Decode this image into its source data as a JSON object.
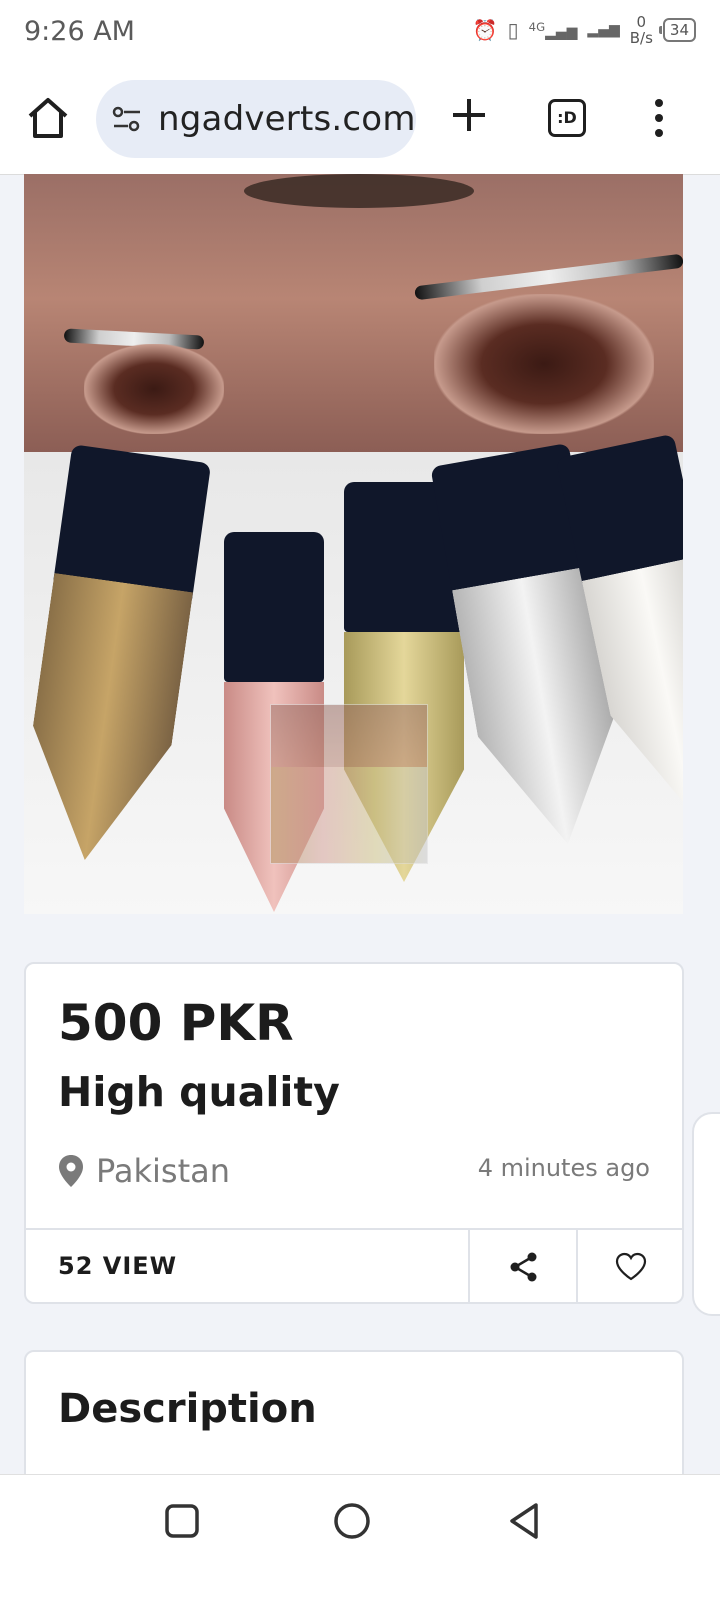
{
  "status_bar": {
    "time": "9:26 AM",
    "network": "4G",
    "speed_value": "0",
    "speed_unit": "B/s",
    "battery": "34"
  },
  "browser": {
    "url": "ngadverts.com",
    "tabs_label": ":D"
  },
  "listing": {
    "price": "500 PKR",
    "title": "High quality",
    "location": "Pakistan",
    "posted": "4 minutes ago",
    "views": "52 VIEW"
  },
  "description": {
    "heading": "Description"
  },
  "colors": {
    "accent_pill": "#e7ecf6",
    "page_bg": "#f1f3f8",
    "muted_text": "#7a7a7a"
  }
}
